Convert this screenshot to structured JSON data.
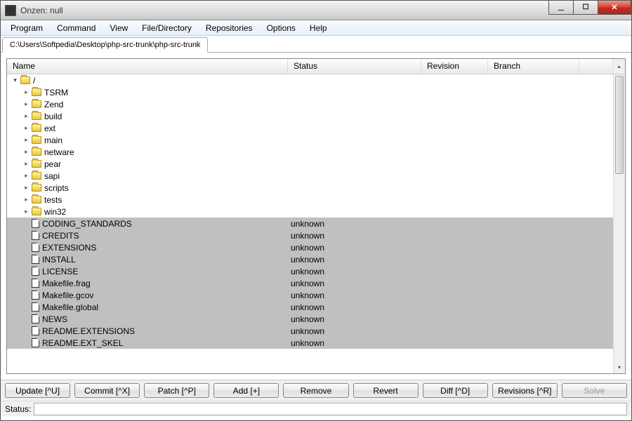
{
  "window": {
    "title": "Onzen: null"
  },
  "menu": {
    "items": [
      "Program",
      "Command",
      "View",
      "File/Directory",
      "Repositories",
      "Options",
      "Help"
    ]
  },
  "tabs": {
    "active": "C:\\Users\\Softpedia\\Desktop\\php-src-trunk\\php-src-trunk"
  },
  "columns": {
    "name": "Name",
    "status": "Status",
    "revision": "Revision",
    "branch": "Branch"
  },
  "tree": {
    "root": {
      "label": "/",
      "expanded": true
    },
    "folders": [
      {
        "label": "TSRM"
      },
      {
        "label": "Zend"
      },
      {
        "label": "build"
      },
      {
        "label": "ext"
      },
      {
        "label": "main"
      },
      {
        "label": "netware"
      },
      {
        "label": "pear"
      },
      {
        "label": "sapi"
      },
      {
        "label": "scripts"
      },
      {
        "label": "tests"
      },
      {
        "label": "win32"
      }
    ],
    "files": [
      {
        "label": "CODING_STANDARDS",
        "status": "unknown"
      },
      {
        "label": "CREDITS",
        "status": "unknown"
      },
      {
        "label": "EXTENSIONS",
        "status": "unknown"
      },
      {
        "label": "INSTALL",
        "status": "unknown"
      },
      {
        "label": "LICENSE",
        "status": "unknown"
      },
      {
        "label": "Makefile.frag",
        "status": "unknown"
      },
      {
        "label": "Makefile.gcov",
        "status": "unknown"
      },
      {
        "label": "Makefile.global",
        "status": "unknown"
      },
      {
        "label": "NEWS",
        "status": "unknown"
      },
      {
        "label": "README.EXTENSIONS",
        "status": "unknown"
      },
      {
        "label": "README.EXT_SKEL",
        "status": "unknown"
      }
    ]
  },
  "buttons": {
    "update": "Update [^U]",
    "commit": "Commit [^X]",
    "patch": "Patch [^P]",
    "add": "Add [+]",
    "remove": "Remove",
    "revert": "Revert",
    "diff": "Diff [^D]",
    "revisions": "Revisions [^R]",
    "solve": "Solve"
  },
  "statusbar": {
    "label": "Status:",
    "value": ""
  }
}
